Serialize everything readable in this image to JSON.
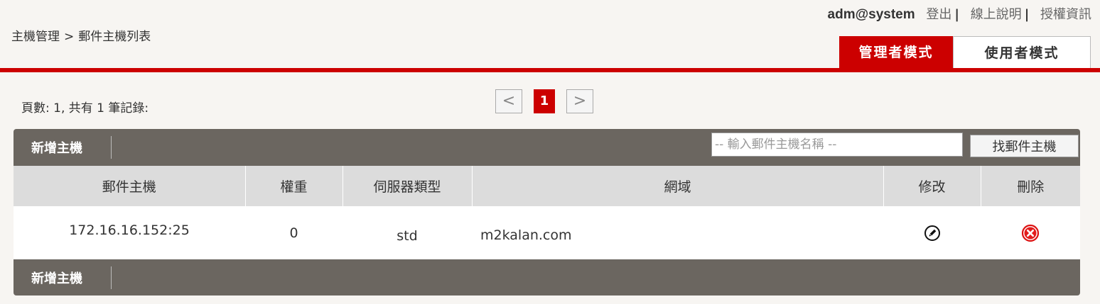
{
  "header": {
    "username": "adm@system",
    "links": [
      "登出",
      "線上說明",
      "授權資訊"
    ],
    "separator": "|"
  },
  "breadcrumb": {
    "parent": "主機管理",
    "arrow": ">",
    "current": "郵件主機列表"
  },
  "modes": {
    "admin": "管理者模式",
    "user": "使用者模式"
  },
  "pagination": {
    "info": "頁數: 1, 共有 1 筆記錄:",
    "prev": "<",
    "current": "1",
    "next": ">"
  },
  "toolbar": {
    "add_label": "新增主機",
    "search_placeholder": "-- 輸入郵件主機名稱 --",
    "search_button": "找郵件主機"
  },
  "table": {
    "columns": [
      "郵件主機",
      "權重",
      "伺服器類型",
      "網域",
      "修改",
      "刪除"
    ],
    "rows": [
      {
        "host": "172.16.16.152:25",
        "weight": "0",
        "type": "std",
        "domain": "m2kalan.com"
      }
    ]
  },
  "icons": {
    "edit": "pencil-circle-icon",
    "delete": "red-x-circle-icon"
  },
  "colors": {
    "accent": "#cc0000",
    "panel": "#6b6660",
    "header_row": "#dcdcdc"
  }
}
